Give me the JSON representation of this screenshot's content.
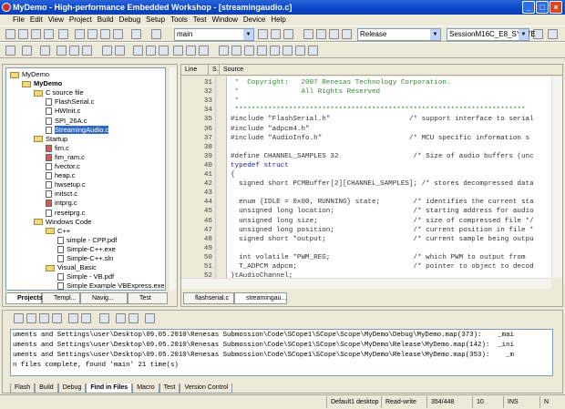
{
  "window": {
    "title": "MyDemo - High-performance Embedded Workshop - [streamingaudio.c]"
  },
  "menu": [
    "File",
    "Edit",
    "View",
    "Project",
    "Build",
    "Debug",
    "Setup",
    "Tools",
    "Test",
    "Window",
    "Device",
    "Help"
  ],
  "toolbar": {
    "find_value": "main",
    "config_value": "Release",
    "session_value": "SessionM16C_E8_SYSTE"
  },
  "tree": [
    {
      "label": "MyDemo",
      "depth": 0,
      "type": "workspace"
    },
    {
      "label": "MyDemo",
      "depth": 1,
      "type": "project",
      "bold": true
    },
    {
      "label": "C source file",
      "depth": 2,
      "type": "folder"
    },
    {
      "label": "FlashSerial.c",
      "depth": 3,
      "type": "file"
    },
    {
      "label": "HWInit.c",
      "depth": 3,
      "type": "file"
    },
    {
      "label": "SPI_26A.c",
      "depth": 3,
      "type": "file"
    },
    {
      "label": "StreamingAudio.c",
      "depth": 3,
      "type": "file",
      "selected": true
    },
    {
      "label": "Startup",
      "depth": 2,
      "type": "folder"
    },
    {
      "label": "fim.c",
      "depth": 3,
      "type": "file-red"
    },
    {
      "label": "fim_ram.c",
      "depth": 3,
      "type": "file-red"
    },
    {
      "label": "fvector.c",
      "depth": 3,
      "type": "file"
    },
    {
      "label": "heap.c",
      "depth": 3,
      "type": "file"
    },
    {
      "label": "hwsetup.c",
      "depth": 3,
      "type": "file"
    },
    {
      "label": "initsct.c",
      "depth": 3,
      "type": "file"
    },
    {
      "label": "intprg.c",
      "depth": 3,
      "type": "file-red"
    },
    {
      "label": "resetprg.c",
      "depth": 3,
      "type": "file"
    },
    {
      "label": "Windows Code",
      "depth": 2,
      "type": "folder"
    },
    {
      "label": "C++",
      "depth": 3,
      "type": "folder"
    },
    {
      "label": "simple - CPP.pdf",
      "depth": 4,
      "type": "file"
    },
    {
      "label": "Simple-C++.exe",
      "depth": 4,
      "type": "file"
    },
    {
      "label": "Simple-C++.sln",
      "depth": 4,
      "type": "file"
    },
    {
      "label": "Visual_Basic",
      "depth": 3,
      "type": "folder"
    },
    {
      "label": "Simple - VB.pdf",
      "depth": 4,
      "type": "file"
    },
    {
      "label": "Simple Example VBExpress.exe",
      "depth": 4,
      "type": "file"
    }
  ],
  "left_tabs": [
    "Projects",
    "Templ...",
    "Navig...",
    "Test"
  ],
  "editor": {
    "headers": [
      "Line",
      "S.",
      "Source"
    ],
    "lines": [
      {
        "n": "31",
        "t": " *  Copyright:   2007 Renesas Technology Corporation.",
        "c": "cm"
      },
      {
        "n": "32",
        "t": " *               All Rights Reserved",
        "c": "cm"
      },
      {
        "n": "33",
        "t": " *",
        "c": "cm"
      },
      {
        "n": "34",
        "t": " **********************************************************************",
        "c": "cm"
      },
      {
        "n": "35",
        "t": "#include \"FlashSerial.h\"                   /* support interface to serial",
        "c": ""
      },
      {
        "n": "36",
        "t": "#include \"adpcm4.h\"",
        "c": ""
      },
      {
        "n": "37",
        "t": "#include \"AudioInfo.h\"                     /* MCU specific information s",
        "c": ""
      },
      {
        "n": "38",
        "t": "",
        "c": ""
      },
      {
        "n": "39",
        "t": "#define CHANNEL_SAMPLES 32                  /* Size of audio buffers (unc",
        "c": ""
      },
      {
        "n": "40",
        "t": "typedef struct",
        "c": "kw"
      },
      {
        "n": "41",
        "t": "{",
        "c": ""
      },
      {
        "n": "42",
        "t": "  signed short PCMBuffer[2][CHANNEL_SAMPLES]; /* stores decompressed data",
        "c": ""
      },
      {
        "n": "43",
        "t": "",
        "c": ""
      },
      {
        "n": "44",
        "t": "  enum {IDLE = 0x00, RUNNING} state;        /* identifies the current sta",
        "c": ""
      },
      {
        "n": "45",
        "t": "  unsigned long location;                   /* starting address for audio",
        "c": ""
      },
      {
        "n": "46",
        "t": "  unsigned long size;                       /* size of compressed file */",
        "c": ""
      },
      {
        "n": "47",
        "t": "  unsigned long position;                   /* current position in file *",
        "c": ""
      },
      {
        "n": "48",
        "t": "  signed short *output;                     /* current sample being outpu",
        "c": ""
      },
      {
        "n": "49",
        "t": "",
        "c": ""
      },
      {
        "n": "50",
        "t": "  int volatile *PWM_REG;                    /* which PWM to output from",
        "c": ""
      },
      {
        "n": "51",
        "t": "  T_ADPCM adpcm;                            /* pointer to object to decod",
        "c": ""
      },
      {
        "n": "52",
        "t": "}tAudioChannel;",
        "c": ""
      },
      {
        "n": "53",
        "t": "",
        "c": ""
      }
    ],
    "tabs": [
      "flashserial.c",
      "streamingau..."
    ]
  },
  "output": {
    "lines": [
      "uments and Settings\\user\\Desktop\\09.05.2010\\Renesas Submossion\\Code\\SCope1\\SCope\\Scope\\MyDemo\\Debug\\MyDemo.map(373):    _mai",
      "uments and Settings\\user\\Desktop\\09.05.2010\\Renesas Submossion\\Code\\SCope1\\SCope\\Scope\\MyDemo\\Release\\MyDemo.map(142):  _ini",
      "uments and Settings\\user\\Desktop\\09.05.2010\\Renesas Submossion\\Code\\SCope1\\SCope\\Scope\\MyDemo\\Release\\MyDemo.map(353):    _m",
      "n files complete, found 'main' 21 time(s)"
    ],
    "tabs": [
      "Flash",
      "Build",
      "Debug",
      "Find in Files",
      "Macro",
      "Test",
      "Version Control"
    ],
    "active_tab": "Find in Files"
  },
  "status": {
    "desktop": "Default1 desktop",
    "mode": "Read-write",
    "position": "354/448",
    "col": "10",
    "ins": "INS",
    "num": "N"
  }
}
